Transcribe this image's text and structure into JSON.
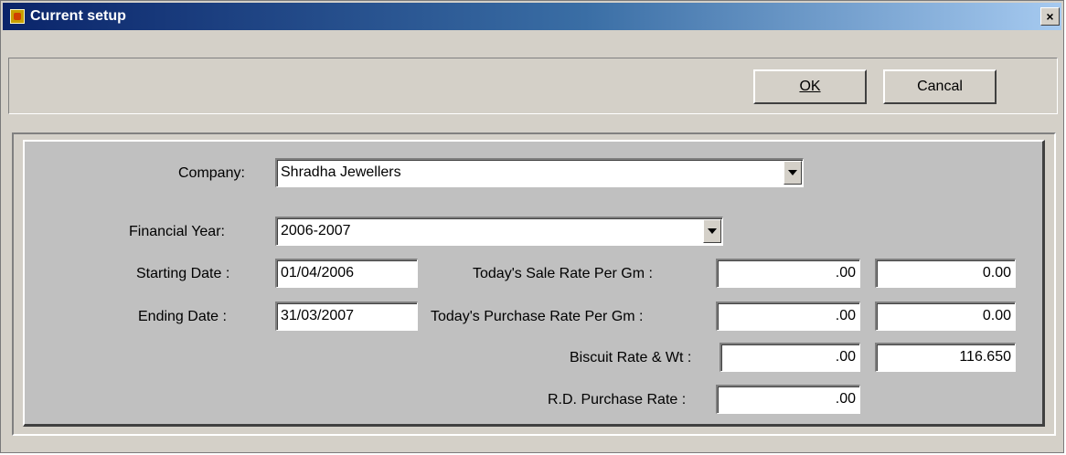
{
  "window": {
    "title": "Current setup",
    "close_label": "×"
  },
  "toolbar": {
    "ok_label": "OK",
    "cancel_label": "Cancal"
  },
  "form": {
    "company_label": "Company:",
    "company_value": "Shradha Jewellers",
    "financial_year_label": "Financial Year:",
    "financial_year_value": "2006-2007",
    "starting_date_label": "Starting Date  :",
    "starting_date_value": "01/04/2006",
    "ending_date_label": "Ending Date  :",
    "ending_date_value": "31/03/2007",
    "sale_rate_label": "Today's Sale Rate Per Gm :",
    "sale_rate_value": ".00",
    "sale_rate_value2": "0.00",
    "purchase_rate_label": "Today's Purchase Rate Per Gm :",
    "purchase_rate_value": ".00",
    "purchase_rate_value2": "0.00",
    "biscuit_label": "Biscuit Rate & Wt :",
    "biscuit_rate_value": ".00",
    "biscuit_wt_value": "116.650",
    "rd_label": "R.D. Purchase Rate :",
    "rd_value": ".00"
  }
}
